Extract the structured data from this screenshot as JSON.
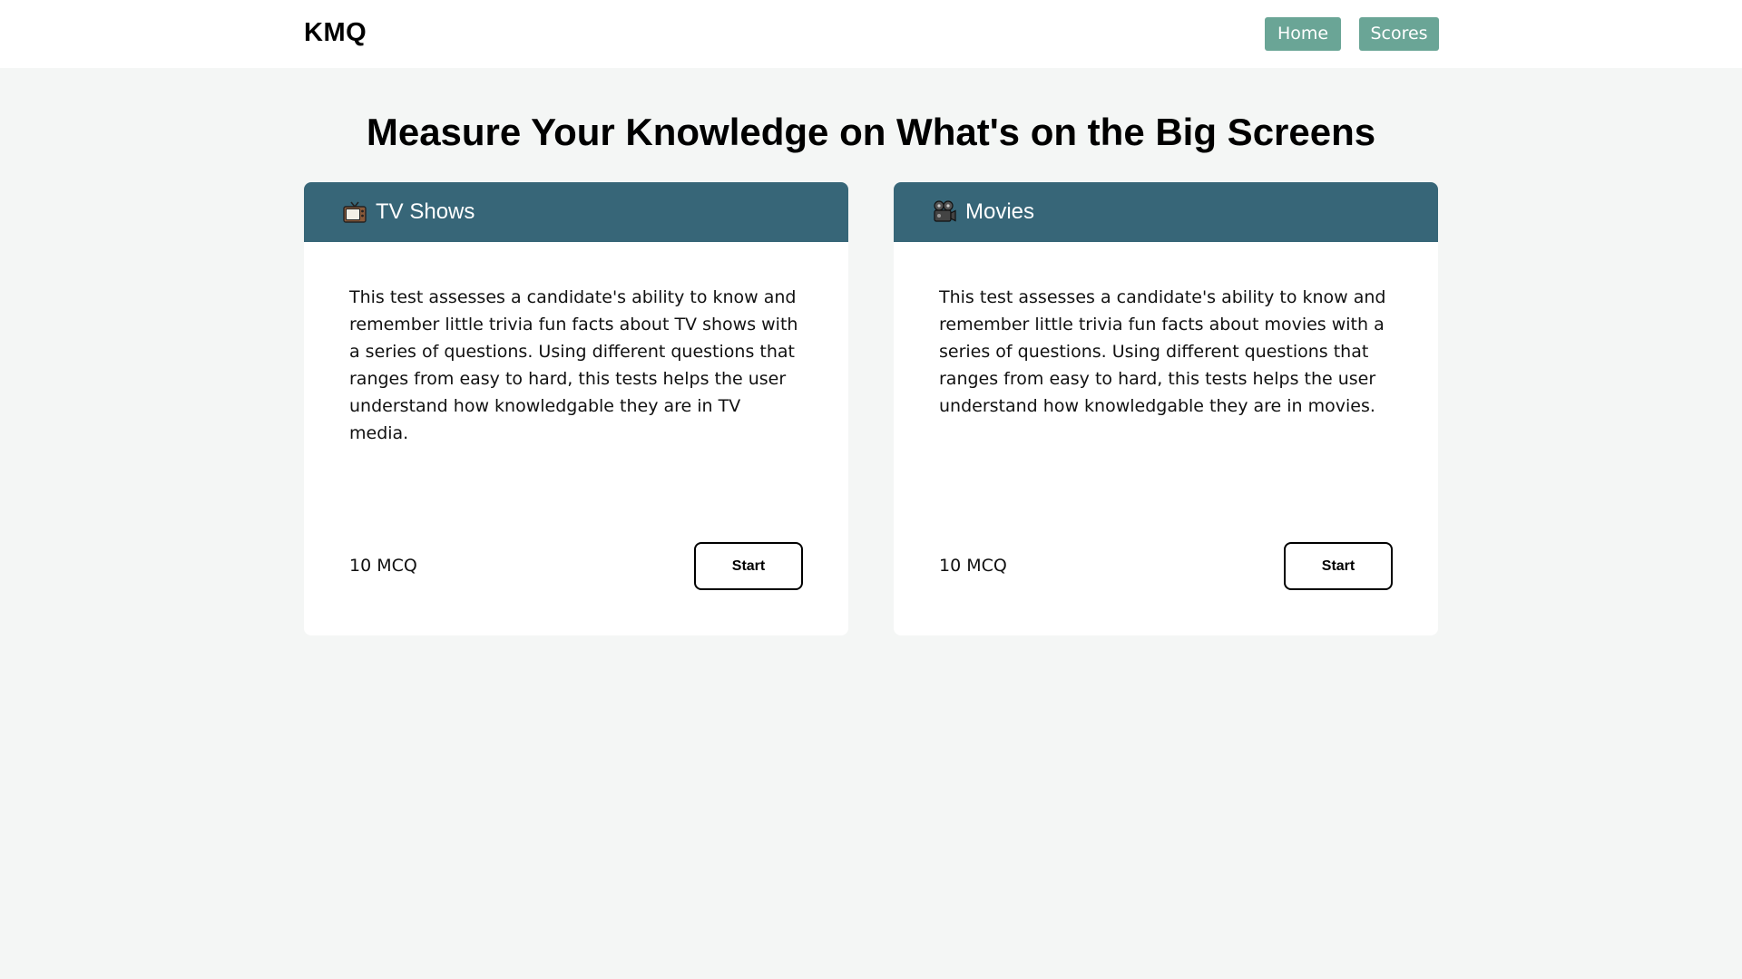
{
  "nav": {
    "brand": "KMQ",
    "home_label": "Home",
    "scores_label": "Scores",
    "button_color": "#6aa596"
  },
  "page": {
    "title": "Measure Your Knowledge on What's on the Big Screens"
  },
  "cards": [
    {
      "icon": "tv-icon",
      "title": "TV Shows",
      "description": "This test assesses a candidate's ability to know and remember little trivia fun facts about TV shows with a series of questions. Using different questions that ranges from easy to hard, this tests helps the user understand how knowledgable they are in TV media.",
      "count": "10 MCQ",
      "start_label": "Start"
    },
    {
      "icon": "movie-camera-icon",
      "title": "Movies",
      "description": "This test assesses a candidate's ability to know and remember little trivia fun facts about movies with a series of questions. Using different questions that ranges from easy to hard, this tests helps the user understand how knowledgable they are in movies.",
      "count": "10 MCQ",
      "start_label": "Start"
    }
  ],
  "colors": {
    "card_header": "#376678",
    "background": "#f4f6f5"
  }
}
